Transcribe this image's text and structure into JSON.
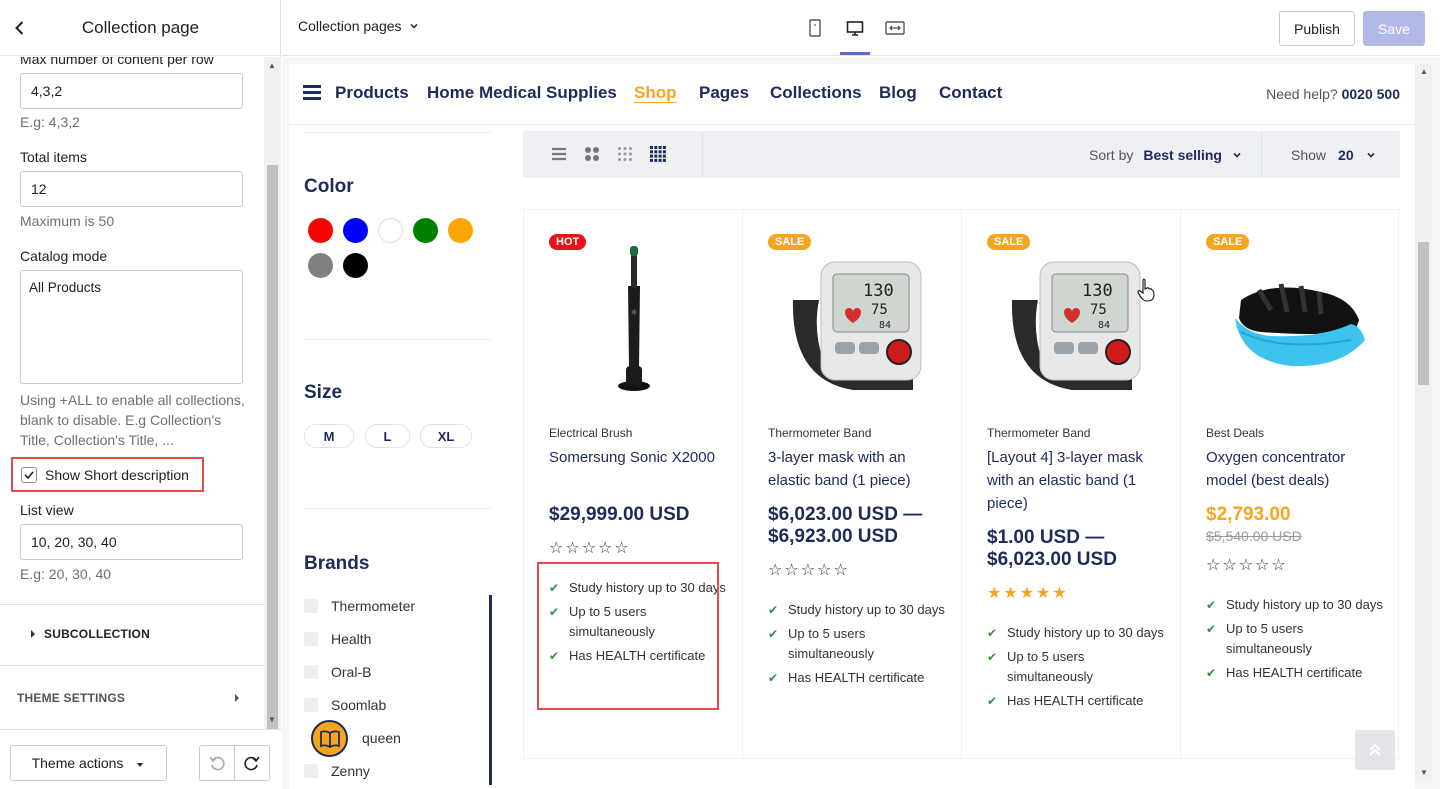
{
  "sidebar": {
    "title": "Collection page",
    "fields": {
      "max_per_row_label": "Max number of content per row",
      "max_per_row_value": "4,3,2",
      "max_per_row_help": "E.g: 4,3,2",
      "total_items_label": "Total items",
      "total_items_value": "12",
      "total_items_help": "Maximum is 50",
      "catalog_mode_label": "Catalog mode",
      "catalog_mode_value": "All Products",
      "catalog_mode_help": "Using +ALL to enable all collections, blank to disable. E.g Collection's Title, Collection's Title, ...",
      "show_short_desc_label": "Show Short description",
      "list_view_label": "List view",
      "list_view_value": "10, 20, 30, 40",
      "list_view_help": "E.g: 20, 30, 40"
    },
    "sections": {
      "subcollection": "SUBCOLLECTION",
      "theme_settings": "THEME SETTINGS"
    },
    "footer": {
      "theme_actions": "Theme actions"
    }
  },
  "topbar": {
    "page_select": "Collection pages",
    "publish": "Publish",
    "save": "Save"
  },
  "store": {
    "nav": [
      "Products",
      "Home Medical Supplies",
      "Shop",
      "Pages",
      "Collections",
      "Blog",
      "Contact"
    ],
    "help_label": "Need help?",
    "help_phone": "0020 500",
    "filters": {
      "color_title": "Color",
      "colors": [
        "#ff0000",
        "#0000ff",
        "#ffffff",
        "#008000",
        "#ffa500",
        "#808080",
        "#000000"
      ],
      "size_title": "Size",
      "sizes": [
        "M",
        "L",
        "XL"
      ],
      "brands_title": "Brands",
      "brands": [
        "Thermometer",
        "Health",
        "Oral-B",
        "Soomlab",
        "queen",
        "Zenny"
      ]
    },
    "toolbar": {
      "sort_label": "Sort by",
      "sort_value": "Best selling",
      "show_label": "Show",
      "show_value": "20"
    },
    "products": [
      {
        "badge": "HOT",
        "category": "Electrical Brush",
        "name": "Somersung Sonic X2000",
        "price": "$29,999.00 USD",
        "rating": 0,
        "features": [
          "Study history up to 30 days",
          "Up to 5 users simultaneously",
          "Has HEALTH certificate"
        ]
      },
      {
        "badge": "SALE",
        "category": "Thermometer Band",
        "name": "3-layer mask with an elastic band (1 piece)",
        "price": "$6,023.00 USD — $6,923.00 USD",
        "rating": 0,
        "features": [
          "Study history up to 30 days",
          "Up to 5 users simultaneously",
          "Has HEALTH certificate"
        ]
      },
      {
        "badge": "SALE",
        "category": "Thermometer Band",
        "name": "[Layout 4] 3-layer mask with an elastic band (1 piece)",
        "price": "$1.00 USD — $6,023.00 USD",
        "rating": 5,
        "features": [
          "Study history up to 30 days",
          "Up to 5 users simultaneously",
          "Has HEALTH certificate"
        ]
      },
      {
        "badge": "SALE",
        "category": "Best Deals",
        "name": "Oxygen concentrator model (best deals)",
        "price": "$2,793.00",
        "old_price": "$5,540.00 USD",
        "rating": 0,
        "features": [
          "Study history up to 30 days",
          "Up to 5 users simultaneously",
          "Has HEALTH certificate"
        ]
      }
    ]
  }
}
